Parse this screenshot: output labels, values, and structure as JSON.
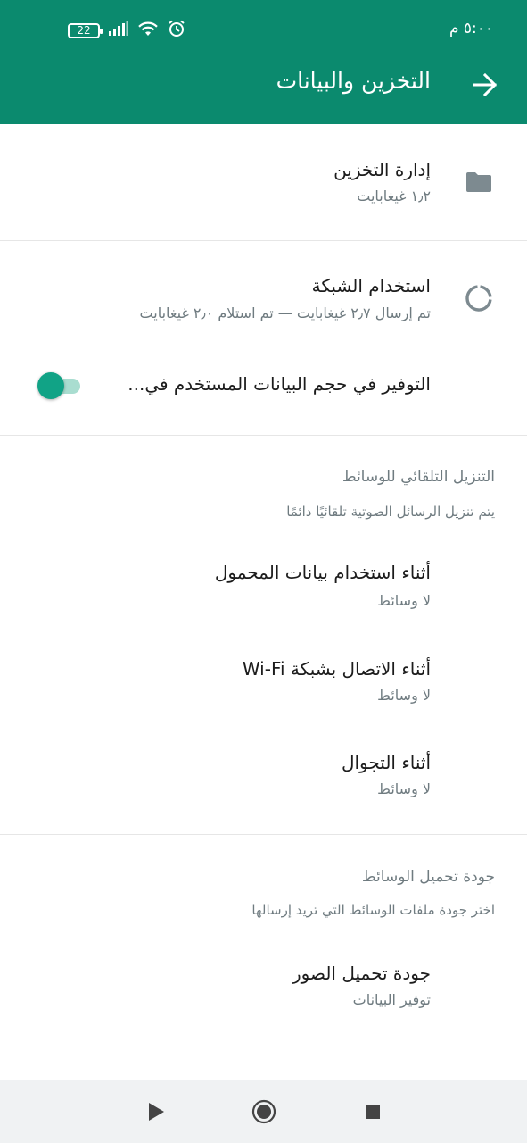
{
  "status_bar": {
    "time": "٥:٠٠ م",
    "battery": "22",
    "icons": [
      "battery-icon",
      "signal-icon",
      "wifi-icon",
      "alarm-icon"
    ]
  },
  "header": {
    "title": "التخزين والبيانات",
    "back_icon": "arrow-back-icon"
  },
  "storage": {
    "title": "إدارة التخزين",
    "subtitle": "١٫٢ غيغابايت",
    "icon": "folder-icon"
  },
  "network": {
    "title": "استخدام الشبكة",
    "subtitle": "تم إرسال ٢٫٧ غيغابايت — تم استلام ٢٫٠ غيغابايت",
    "icon": "data-usage-icon"
  },
  "data_saver": {
    "label": "التوفير في حجم البيانات المستخدم في...",
    "enabled": true
  },
  "auto_download": {
    "header": "التنزيل التلقائي للوسائط",
    "note": "يتم تنزيل الرسائل الصوتية تلقائيًا دائمًا",
    "items": [
      {
        "title": "أثناء استخدام بيانات المحمول",
        "subtitle": "لا وسائط"
      },
      {
        "title": "أثناء الاتصال بشبكة Wi-Fi",
        "subtitle": "لا وسائط"
      },
      {
        "title": "أثناء التجوال",
        "subtitle": "لا وسائط"
      }
    ]
  },
  "upload_quality": {
    "header": "جودة تحميل الوسائط",
    "note": "اختر جودة ملفات الوسائط التي تريد إرسالها",
    "photo_title": "جودة تحميل الصور",
    "photo_value": "توفير البيانات"
  },
  "colors": {
    "appbar": "#0b8a6e",
    "accent": "#11a386",
    "icon_gray": "#7d8a90"
  },
  "navbar": {
    "icons": [
      "back-triangle-icon",
      "home-circle-icon",
      "recents-square-icon"
    ]
  }
}
